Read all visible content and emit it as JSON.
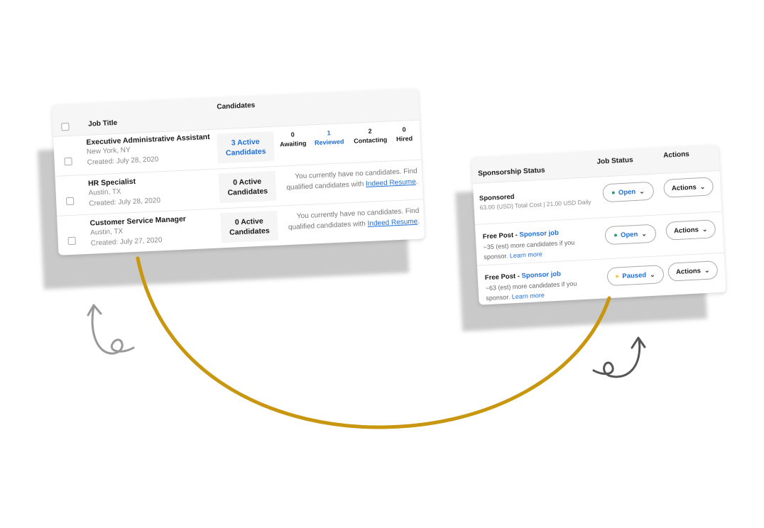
{
  "jobs_table": {
    "headers": {
      "job_title": "Job Title",
      "candidates": "Candidates"
    },
    "stage_labels": [
      "Awaiting",
      "Reviewed",
      "Contacting",
      "Hired"
    ],
    "rows": [
      {
        "title": "Executive Administrative Assistant",
        "location": "New York, NY",
        "created": "Created: July 28, 2020",
        "active": "3 Active Candidates",
        "stages": [
          "0",
          "1",
          "2",
          "0"
        ]
      },
      {
        "title": "HR Specialist",
        "location": "Austin, TX",
        "created": "Created: July 28, 2020",
        "active": "0 Active Candidates",
        "message": "You currently have no candidates. Find qualified candidates with",
        "link": "Indeed Resume",
        "end": "."
      },
      {
        "title": "Customer Service Manager",
        "location": "Austin, TX",
        "created": "Created: July 27, 2020",
        "active": "0 Active Candidates",
        "message": "You currently have no candidates. Find qualified candidates with",
        "link": "Indeed Resume",
        "end": "."
      }
    ]
  },
  "sponsor_table": {
    "headers": {
      "sponsorship": "Sponsorship Status",
      "job_status": "Job Status",
      "actions": "Actions"
    },
    "rows": [
      {
        "title": "Sponsored",
        "detail": "63.00 (USD) Total Cost | 21.00 USD Daily",
        "status": "Open",
        "status_color": "#2e9e6b",
        "actions": "Actions"
      },
      {
        "title": "Free Post - ",
        "sponsor_link": "Sponsor job",
        "detail": "~35 (est) more candidates if you sponsor.",
        "learn": "Learn more",
        "status": "Open",
        "status_color": "#2e9e6b",
        "actions": "Actions"
      },
      {
        "title": "Free Post - ",
        "sponsor_link": "Sponsor job",
        "detail": "~63 (est) more candidates if you sponsor.",
        "learn": "Learn more",
        "status": "Paused",
        "status_color": "#f2c94c",
        "actions": "Actions"
      }
    ]
  },
  "colors": {
    "accent": "#1f6fd6",
    "arc": "#c9960f"
  }
}
